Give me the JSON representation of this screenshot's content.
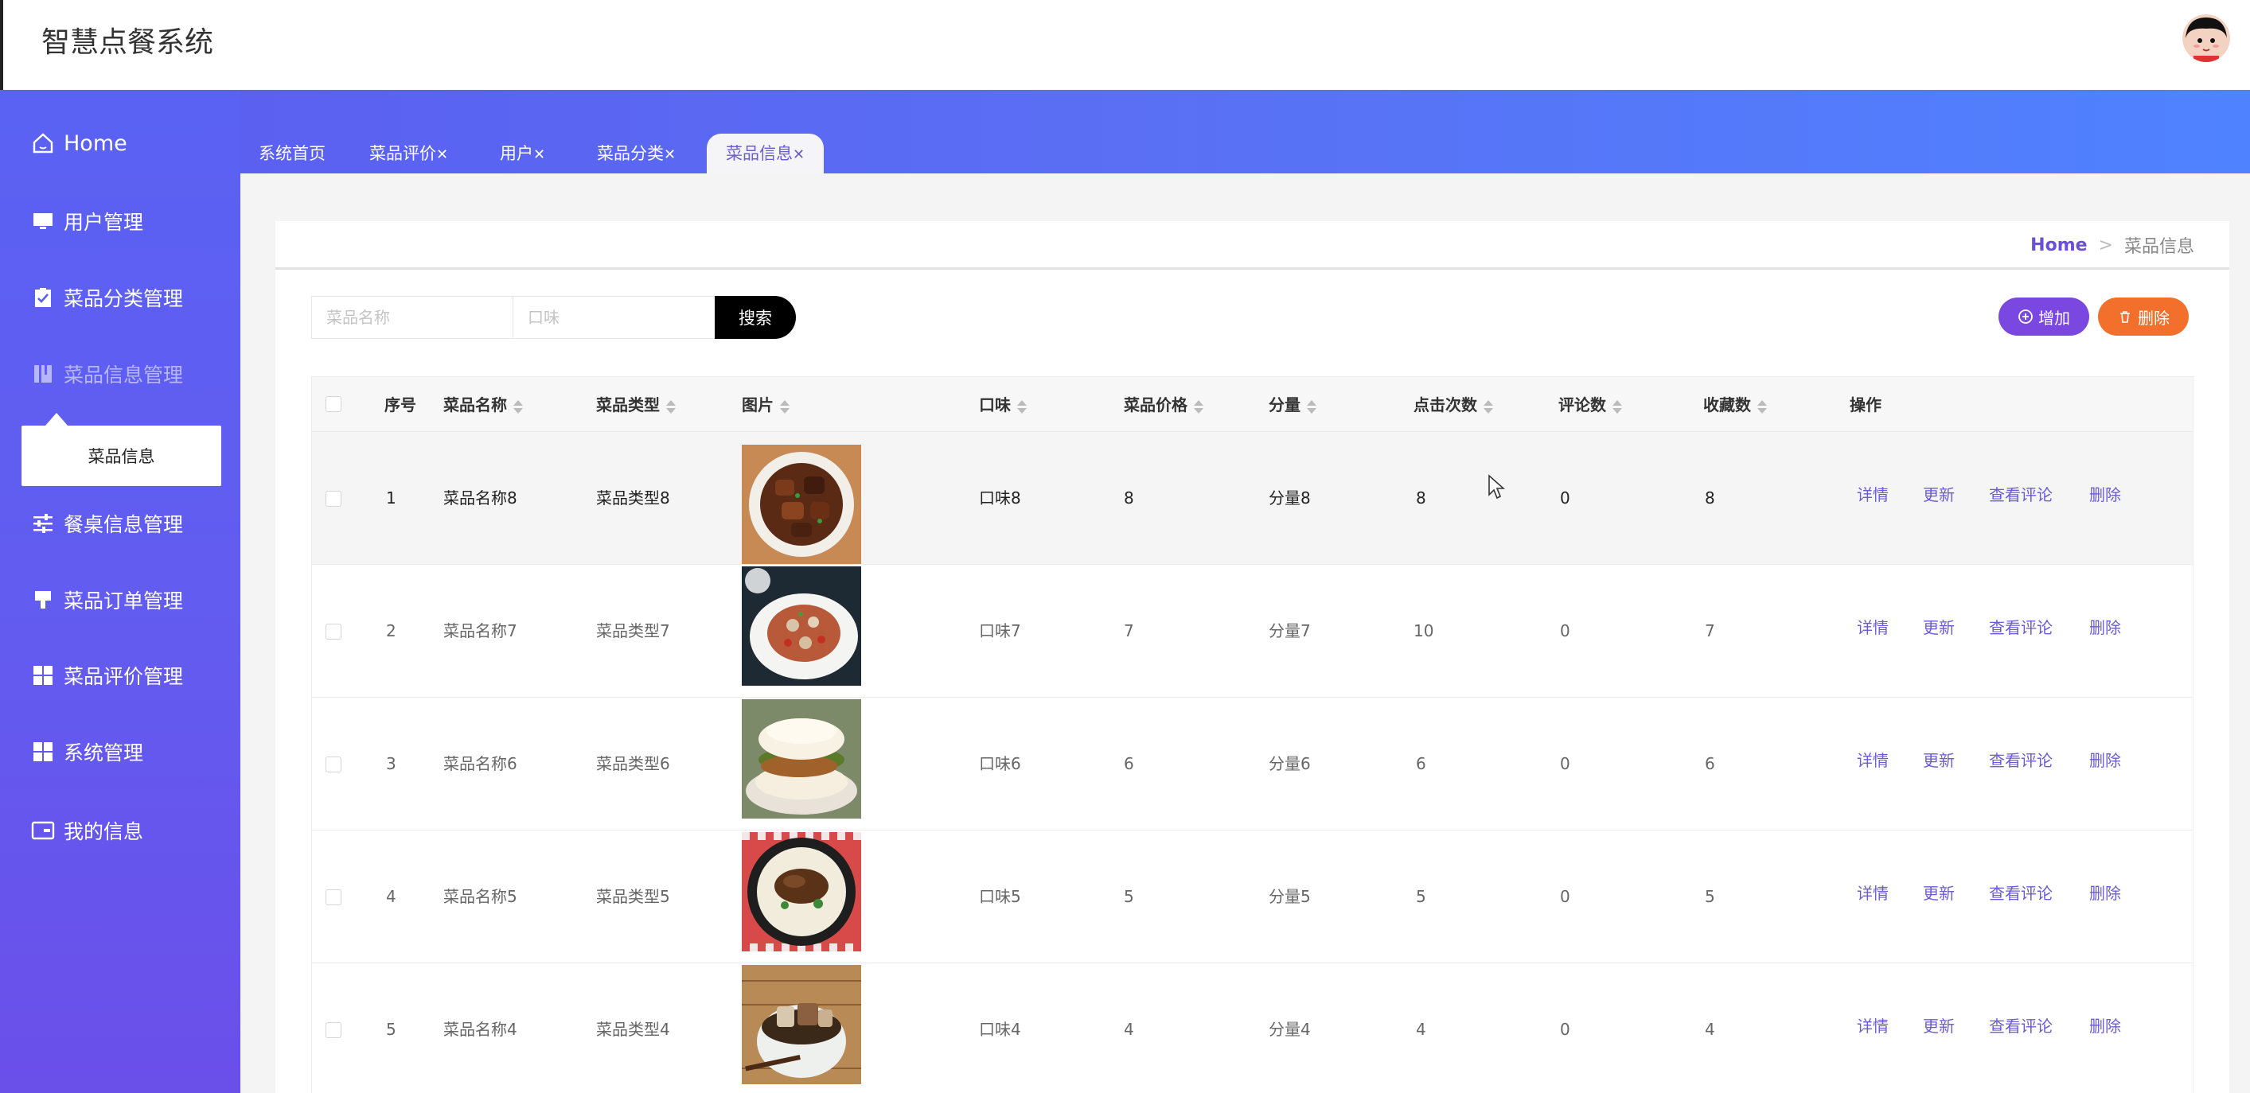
{
  "app": {
    "title": "智慧点餐系统"
  },
  "sidebar": {
    "home": "Home",
    "items": [
      {
        "label": "用户管理",
        "icon": "monitor-icon"
      },
      {
        "label": "菜品分类管理",
        "icon": "clipboard-check-icon"
      },
      {
        "label": "菜品信息管理",
        "icon": "book-icon",
        "active": true
      },
      {
        "label": "餐桌信息管理",
        "icon": "sliders-icon"
      },
      {
        "label": "菜品订单管理",
        "icon": "brush-icon"
      },
      {
        "label": "菜品评价管理",
        "icon": "grid-icon"
      },
      {
        "label": "系统管理",
        "icon": "grid-icon"
      },
      {
        "label": "我的信息",
        "icon": "wallet-icon"
      }
    ],
    "submenu": {
      "label": "菜品信息"
    }
  },
  "tabs": [
    {
      "label": "系统首页",
      "closable": false
    },
    {
      "label": "菜品评价",
      "closable": true
    },
    {
      "label": "用户",
      "closable": true
    },
    {
      "label": "菜品分类",
      "closable": true
    },
    {
      "label": "菜品信息",
      "closable": true,
      "active": true
    }
  ],
  "tab_close": "✕",
  "breadcrumb": {
    "home": "Home",
    "sep": ">",
    "current": "菜品信息"
  },
  "search": {
    "name_placeholder": "菜品名称",
    "taste_placeholder": "口味",
    "button": "搜索"
  },
  "actions": {
    "add": "增加",
    "delete": "删除"
  },
  "table": {
    "headers": {
      "index": "序号",
      "name": "菜品名称",
      "type": "菜品类型",
      "image": "图片",
      "taste": "口味",
      "price": "菜品价格",
      "portion": "分量",
      "clicks": "点击次数",
      "reviews": "评论数",
      "favorites": "收藏数",
      "ops": "操作"
    },
    "row_actions": {
      "detail": "详情",
      "update": "更新",
      "reviews": "查看评论",
      "delete": "删除"
    },
    "rows": [
      {
        "index": "1",
        "name": "菜品名称8",
        "type": "菜品类型8",
        "taste": "口味8",
        "price": "8",
        "portion": "分量8",
        "clicks": "8",
        "reviews": "0",
        "favorites": "8"
      },
      {
        "index": "2",
        "name": "菜品名称7",
        "type": "菜品类型7",
        "taste": "口味7",
        "price": "7",
        "portion": "分量7",
        "clicks": "10",
        "reviews": "0",
        "favorites": "7"
      },
      {
        "index": "3",
        "name": "菜品名称6",
        "type": "菜品类型6",
        "taste": "口味6",
        "price": "6",
        "portion": "分量6",
        "clicks": "6",
        "reviews": "0",
        "favorites": "6"
      },
      {
        "index": "4",
        "name": "菜品名称5",
        "type": "菜品类型5",
        "taste": "口味5",
        "price": "5",
        "portion": "分量5",
        "clicks": "5",
        "reviews": "0",
        "favorites": "5"
      },
      {
        "index": "5",
        "name": "菜品名称4",
        "type": "菜品类型4",
        "taste": "口味4",
        "price": "4",
        "portion": "分量4",
        "clicks": "4",
        "reviews": "0",
        "favorites": "4"
      }
    ]
  },
  "colors": {
    "accent": "#6b5bd8",
    "add": "#7a47e0",
    "delete": "#f36f2c",
    "sidebar_top": "#5a62f3",
    "sidebar_bottom": "#6a4fe9"
  }
}
